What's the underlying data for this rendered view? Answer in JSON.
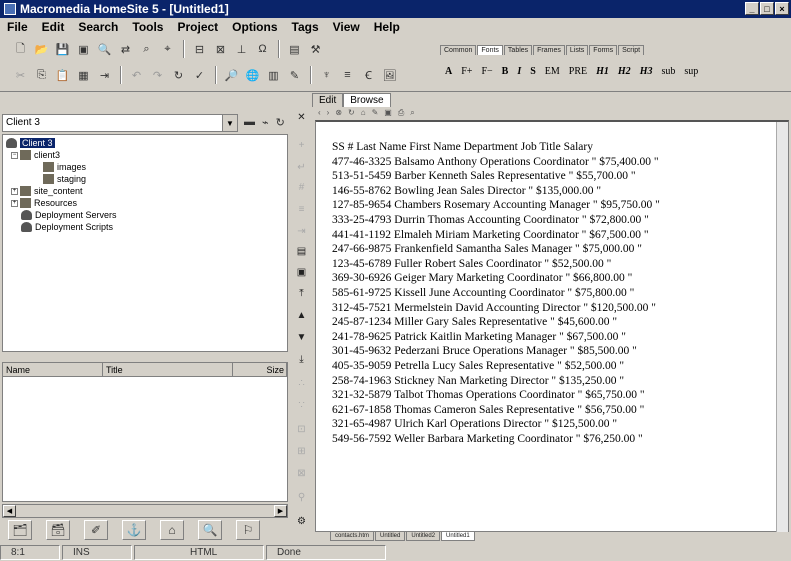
{
  "app": {
    "title": "Macromedia HomeSite 5 - [Untitled1]"
  },
  "window_controls": [
    "_",
    "□",
    "×"
  ],
  "menu": [
    "File",
    "Edit",
    "Search",
    "Tools",
    "Project",
    "Options",
    "Tags",
    "View",
    "Help"
  ],
  "tag_tabs": [
    "Common",
    "Fonts",
    "Tables",
    "Frames",
    "Lists",
    "Forms",
    "Script"
  ],
  "tag_tabs_active": "Fonts",
  "tag_buttons": [
    "A",
    "F+",
    "F−",
    "B",
    "I",
    "S",
    "EM",
    "PRE",
    "H1",
    "H2",
    "H3",
    "sub",
    "sup"
  ],
  "left_panel": {
    "combo_value": "Client 3",
    "tree": [
      {
        "label": "Client 3",
        "indent": 0,
        "icon": "server-icon",
        "selected": true
      },
      {
        "label": "client3",
        "indent": 1,
        "icon": "folder-icon",
        "expand": "−"
      },
      {
        "label": "images",
        "indent": 2,
        "icon": "folder-icon"
      },
      {
        "label": "staging",
        "indent": 2,
        "icon": "folder-icon"
      },
      {
        "label": "site_content",
        "indent": 1,
        "icon": "folder-icon",
        "expand": "+"
      },
      {
        "label": "Resources",
        "indent": 1,
        "icon": "folder-icon",
        "expand": "+"
      },
      {
        "label": "Deployment Servers",
        "indent": 1,
        "icon": "server-icon"
      },
      {
        "label": "Deployment Scripts",
        "indent": 1,
        "icon": "script-icon"
      }
    ],
    "file_columns": [
      "Name",
      "Title",
      "Size"
    ]
  },
  "editor": {
    "tabs": [
      "Edit",
      "Browse"
    ],
    "active_tab": "Browse",
    "lines": [
      "SS # Last Name First Name Department Job Title Salary",
      "477-46-3325 Balsamo Anthony Operations Coordinator \" $75,400.00 \"",
      "513-51-5459 Barber Kenneth Sales Representative \" $55,700.00 \"",
      "146-55-8762 Bowling Jean Sales Director \" $135,000.00 \"",
      "127-85-9654 Chambers Rosemary Accounting Manager \" $95,750.00 \"",
      "333-25-4793 Durrin Thomas Accounting Coordinator \" $72,800.00 \"",
      "441-41-1192 Elmaleh Miriam Marketing Coordinator \" $67,500.00 \"",
      "247-66-9875 Frankenfield Samantha Sales Manager \" $75,000.00 \"",
      "123-45-6789 Fuller Robert Sales Coordinator \" $52,500.00 \"",
      "369-30-6926 Geiger Mary Marketing Coordinator \" $66,800.00 \"",
      "585-61-9725 Kissell June Accounting Coordinator \" $75,800.00 \"",
      "312-45-7521 Mermelstein David Accounting Director \" $120,500.00 \"",
      "245-87-1234 Miller Gary Sales Representative \" $45,600.00 \"",
      "241-78-9625 Patrick Kaitlin Marketing Manager \" $67,500.00 \"",
      "301-45-9632 Pederzani Bruce Operations Manager \" $85,500.00 \"",
      "405-35-9059 Petrella Lucy Sales Representative \" $52,500.00 \"",
      "258-74-1963 Stickney Nan Marketing Director \" $135,250.00 \"",
      "321-32-5879 Talbot Thomas Operations Coordinator \" $65,750.00 \"",
      "621-67-1858 Thomas Cameron Sales Representative \" $56,750.00 \"",
      "321-65-4987 Ulrich Karl Operations Director \" $125,500.00 \"",
      "549-56-7592 Weller Barbara Marketing Coordinator \" $76,250.00 \""
    ]
  },
  "doc_tabs": [
    "contacts.htm",
    "Untitled",
    "Untitled2",
    "Untitled1"
  ],
  "doc_tab_active": "Untitled1",
  "status": {
    "position": "8:1",
    "mode": "INS",
    "type": "HTML",
    "message": "Done"
  }
}
